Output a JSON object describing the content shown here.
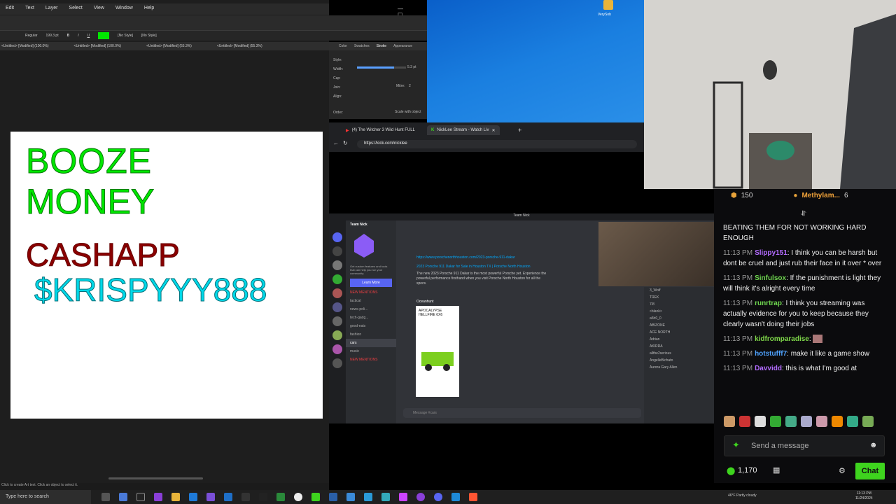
{
  "editor": {
    "menu": [
      "Edit",
      "Text",
      "Layer",
      "Select",
      "View",
      "Window",
      "Help"
    ],
    "font_style": "Regular",
    "font_size": "199.3 pt",
    "style_label": "[No Style]",
    "paragraph_style": "[No Style]",
    "tabs": [
      "<Untitled> [Modified] (100.0%)",
      "<Untitled> [Modified] (100.0%)",
      "<Untitled> [Modified] (55.3%)",
      "<Untitled> [Modified] (55.3%)"
    ],
    "canvas_lines": [
      "BOOZE",
      "MONEY",
      "CASHAPP",
      "$KRISPYYY888"
    ],
    "status_text": "Click to create Art text. Click an object to select it.",
    "text_color": "#00e600"
  },
  "stroke_panel": {
    "tabs": [
      "Color",
      "Swatches",
      "Stroke",
      "Appearance"
    ],
    "rows": [
      "Style:",
      "Width:",
      "Cap:",
      "Join:",
      "Align:",
      "Order:"
    ],
    "width_value": "5.3 pt",
    "mitre_label": "Mitre:",
    "mitre_value": "2",
    "scale_label": "Scale with object"
  },
  "desktop": {
    "icon_label": "VerySob"
  },
  "browser": {
    "tabs": [
      "(4) The Witcher 3 Wild Hunt FULL",
      "NickLee Stream - Watch Liv"
    ],
    "url": "https://kick.com/nicklee"
  },
  "discord": {
    "title": "Team Nick",
    "server_name": "Team Nick",
    "promo_text": "Get custom features and tools that can help you run your community.",
    "learn_more": "Learn More",
    "channels": [
      "NEW MENTIONS",
      "tactical",
      "news-poli...",
      "tech-gadg...",
      "good-eats",
      "fashion",
      "cars",
      "music",
      "NEW MENTIONS"
    ],
    "link_url": "https://www.porschenorthhouston.com/2023-porsche-911-dakar",
    "link_title": "2023 Porsche 911 Dakar for Sale in Houston TX | Porsche North Houston",
    "link_desc": "The new 2023 Porsche 911 Dakar is the most powerful Porsche yet. Experience the powerful performance firsthand when you visit Porsche North Houston for all the specs.",
    "poster": "Oceanhunt",
    "embed_title": "APOCALYPSE HELLFIRE 6X6",
    "members": [
      "3_Wolf",
      "TREK",
      "7/8",
      "<blank>",
      "a5h0_0",
      "ABIZONE",
      "ACE NORTH",
      "Adrian",
      "AKIRRA",
      "allthe2serious",
      "AngelleBichato",
      "Aurora Gary Allen"
    ],
    "message_placeholder": "Message #cars"
  },
  "chat": {
    "top_count": "150",
    "top_user": "Methylam...",
    "top_user_count": "6",
    "messages": [
      {
        "time": "",
        "user": "",
        "color": "#f0f0f0",
        "text": "BEATING THEM FOR NOT WORKING HARD ENOUGH"
      },
      {
        "time": "11:13 PM",
        "user": "Slippy151",
        "color": "#b36cff",
        "text": "I think you can be harsh but dont be cruel and just rub their face in it over * over"
      },
      {
        "time": "11:13 PM",
        "user": "Sinfulsox",
        "color": "#6dd34e",
        "text": "If the punishment is light they will think it's alright every time"
      },
      {
        "time": "11:13 PM",
        "user": "runrtrap",
        "color": "#6dd34e",
        "text": "I think you streaming was actually evidence for you to keep because they clearly wasn't doing their jobs"
      },
      {
        "time": "11:13 PM",
        "user": "kidfromparadise",
        "color": "#7fd84a",
        "text": ""
      },
      {
        "time": "11:13 PM",
        "user": "hotstufff7",
        "color": "#4fa3ff",
        "text": "make it like a game show"
      },
      {
        "time": "11:13 PM",
        "user": "Davvidd",
        "color": "#b36cff",
        "text": "this is what I'm good at"
      }
    ],
    "placeholder": "Send a message",
    "points": "1,170",
    "chat_button": "Chat",
    "accent": "#3ed41e"
  },
  "taskbar": {
    "search_placeholder": "Type here to search",
    "weather": "46°F  Partly cloudy",
    "time": "11:13 PM",
    "date": "11/24/2024"
  }
}
